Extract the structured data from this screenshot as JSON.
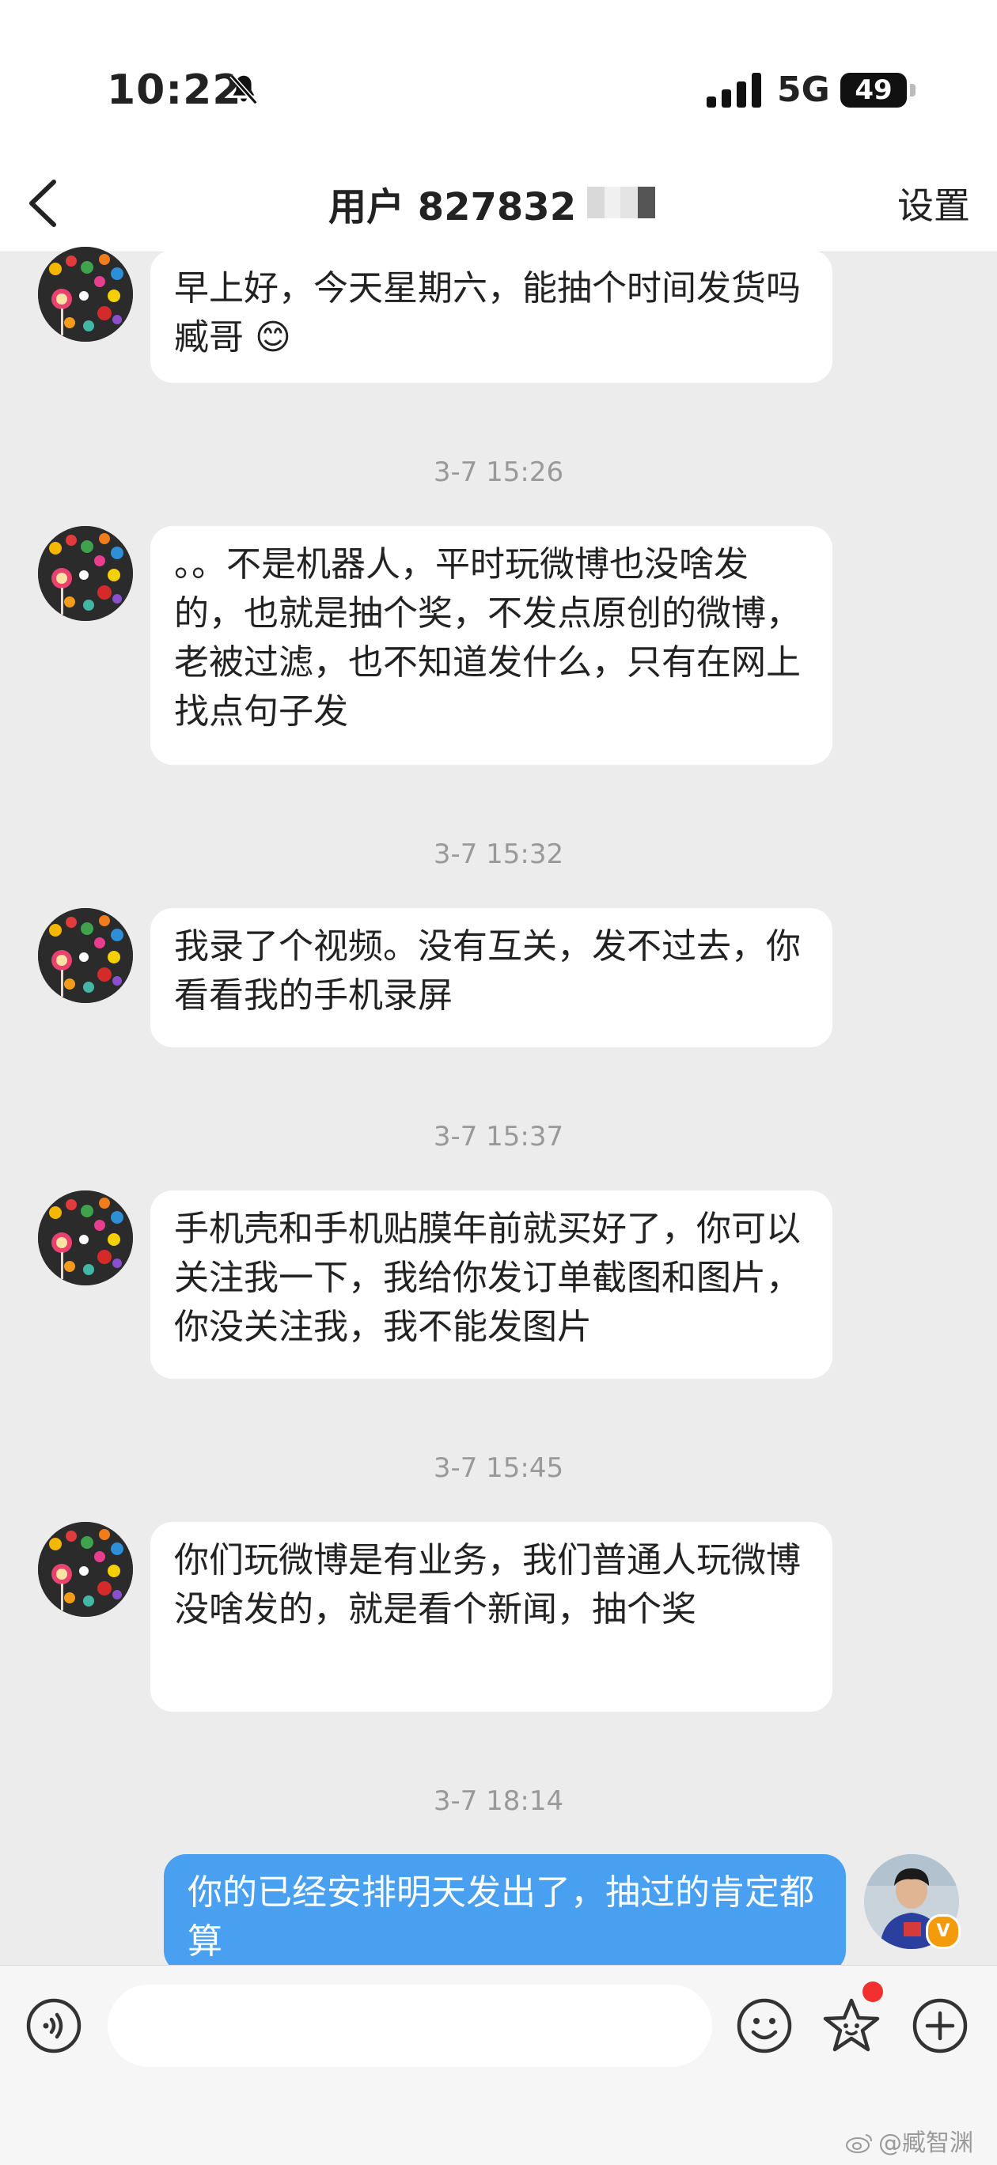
{
  "status_bar": {
    "time": "10:22",
    "network": "5G",
    "battery": "49"
  },
  "header": {
    "title": "用户 827832",
    "settings_label": "设置"
  },
  "messages": [
    {
      "text": "早上好，今天星期六，能抽个时间发货吗臧哥 😊"
    },
    {
      "timestamp": "3-7 15:26",
      "text": "。。不是机器人，平时玩微博也没啥发的，也就是抽个奖，不发点原创的微博，老被过滤，也不知道发什么，只有在网上找点句子发"
    },
    {
      "timestamp": "3-7 15:32",
      "text": "我录了个视频。没有互关，发不过去，你看看我的手机录屏"
    },
    {
      "timestamp": "3-7 15:37",
      "text": "手机壳和手机贴膜年前就买好了，你可以关注我一下，我给你发订单截图和图片，你没关注我，我不能发图片"
    },
    {
      "timestamp": "3-7 15:45",
      "text": "你们玩微博是有业务，我们普通人玩微博没啥发的，就是看个新闻，抽个奖"
    },
    {
      "timestamp": "3-7 18:14",
      "text": "你的已经安排明天发出了，抽过的肯定都算"
    }
  ],
  "verified_badge": "V",
  "watermark": "@臧智渊",
  "icons": [
    "bell-off-icon",
    "signal-icon",
    "back-icon",
    "voice-icon",
    "emoji-icon",
    "sticker-star-icon",
    "plus-icon",
    "weibo-logo-icon"
  ],
  "colors": {
    "my_bubble": "#4aa0f0",
    "background": "#ececec",
    "badge": "#f49b0b",
    "notification_dot": "#f23030"
  }
}
